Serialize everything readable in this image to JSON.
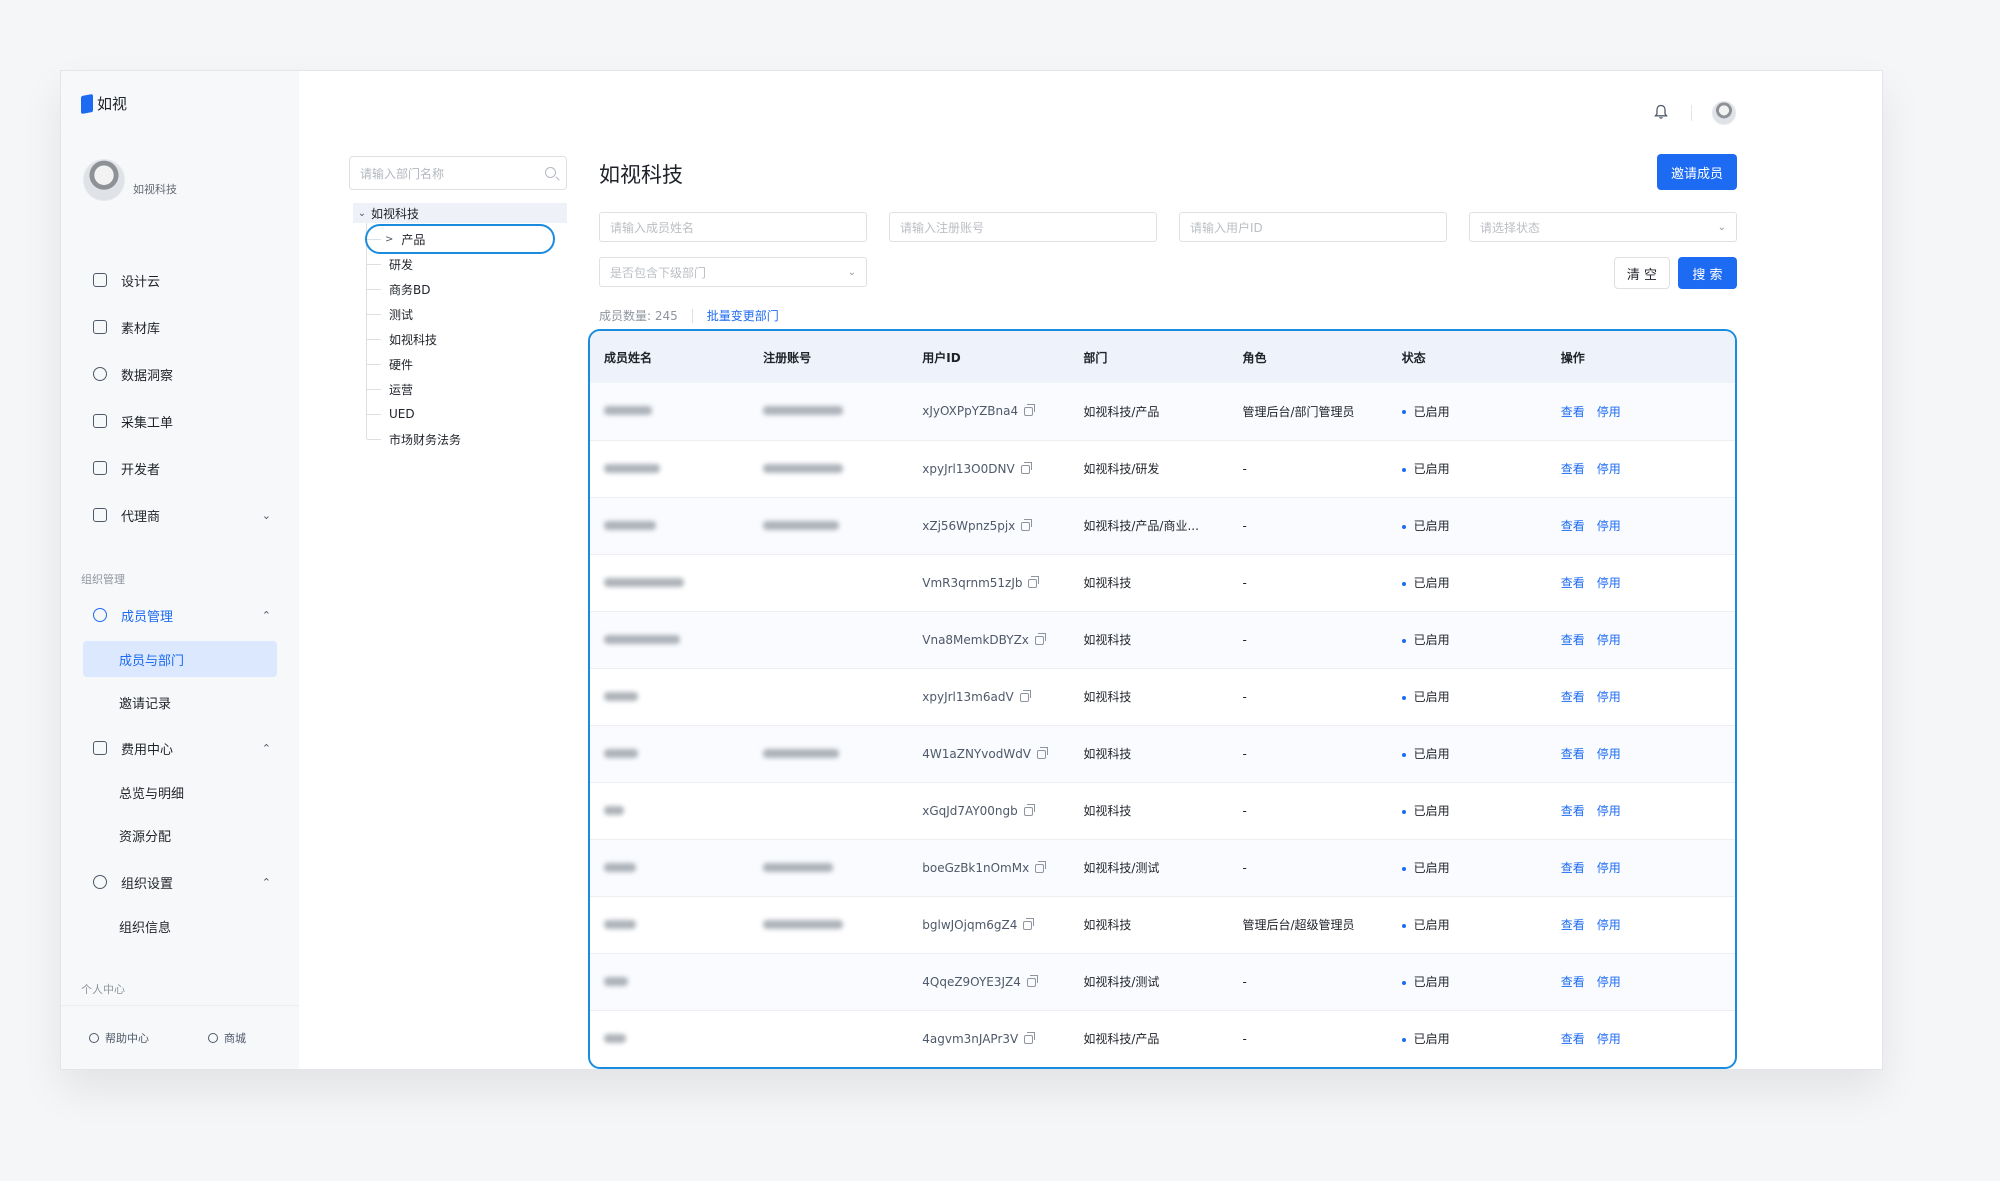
{
  "brand": {
    "name": "如视"
  },
  "profile": {
    "org_name": "如视科技"
  },
  "sidebar": {
    "items": [
      {
        "label": "设计云",
        "icon": "monitor-icon"
      },
      {
        "label": "素材库",
        "icon": "folder-icon"
      },
      {
        "label": "数据洞察",
        "icon": "pie-chart-icon"
      },
      {
        "label": "采集工单",
        "icon": "document-icon"
      },
      {
        "label": "开发者",
        "icon": "code-icon"
      },
      {
        "label": "代理商",
        "icon": "briefcase-icon"
      }
    ],
    "org_group_label": "组织管理",
    "member_mgmt": {
      "label": "成员管理",
      "icon": "users-icon"
    },
    "member_subs": [
      "成员与部门",
      "邀请记录"
    ],
    "billing": {
      "label": "费用中心",
      "icon": "wallet-icon"
    },
    "billing_subs": [
      "总览与明细",
      "资源分配"
    ],
    "org_settings": {
      "label": "组织设置",
      "icon": "shield-icon"
    },
    "org_settings_subs": [
      "组织信息"
    ],
    "personal_label": "个人中心",
    "bottom": {
      "help": "帮助中心",
      "store": "商城"
    }
  },
  "tree": {
    "search_placeholder": "请输入部门名称",
    "root": "如视科技",
    "children": [
      "产品",
      "研发",
      "商务BD",
      "测试",
      "如视科技",
      "硬件",
      "运营",
      "UED",
      "市场财务法务"
    ]
  },
  "main": {
    "title": "如视科技",
    "invite_button": "邀请成员",
    "filters": {
      "name_placeholder": "请输入成员姓名",
      "account_placeholder": "请输入注册账号",
      "userid_placeholder": "请输入用户ID",
      "status_placeholder": "请选择状态",
      "subdept_placeholder": "是否包含下级部门"
    },
    "clear_button": "清 空",
    "search_button": "搜 索",
    "member_count": "成员数量: 245",
    "batch_change": "批量变更部门"
  },
  "table": {
    "headers": [
      "成员姓名",
      "注册账号",
      "用户ID",
      "部门",
      "角色",
      "状态",
      "操作"
    ],
    "rows": [
      {
        "user_id": "xJyOXPpYZBna4",
        "dept": "如视科技/产品",
        "role": "管理后台/部门管理员",
        "status": "已启用"
      },
      {
        "user_id": "xpyJrl13O0DNV",
        "dept": "如视科技/研发",
        "role": "-",
        "status": "已启用"
      },
      {
        "user_id": "xZj56Wpnz5pjx",
        "dept": "如视科技/产品/商业...",
        "role": "-",
        "status": "已启用"
      },
      {
        "user_id": "VmR3qrnm51zJb",
        "dept": "如视科技",
        "role": "-",
        "status": "已启用"
      },
      {
        "user_id": "Vna8MemkDBYZx",
        "dept": "如视科技",
        "role": "-",
        "status": "已启用"
      },
      {
        "user_id": "xpyJrl13m6adV",
        "dept": "如视科技",
        "role": "-",
        "status": "已启用"
      },
      {
        "user_id": "4W1aZNYvodWdV",
        "dept": "如视科技",
        "role": "-",
        "status": "已启用"
      },
      {
        "user_id": "xGqJd7AY00ngb",
        "dept": "如视科技",
        "role": "-",
        "status": "已启用"
      },
      {
        "user_id": "boeGzBk1nOmMx",
        "dept": "如视科技/测试",
        "role": "-",
        "status": "已启用"
      },
      {
        "user_id": "bglwJOjqm6gZ4",
        "dept": "如视科技",
        "role": "管理后台/超级管理员",
        "status": "已启用"
      },
      {
        "user_id": "4QqeZ9OYE3JZ4",
        "dept": "如视科技/测试",
        "role": "-",
        "status": "已启用"
      },
      {
        "user_id": "4agvm3nJAPr3V",
        "dept": "如视科技/产品",
        "role": "-",
        "status": "已启用"
      }
    ],
    "actions": {
      "view": "查看",
      "disable": "停用"
    }
  },
  "colors": {
    "accent": "#1d6bf3",
    "highlight_outline": "#1a8ce0"
  }
}
